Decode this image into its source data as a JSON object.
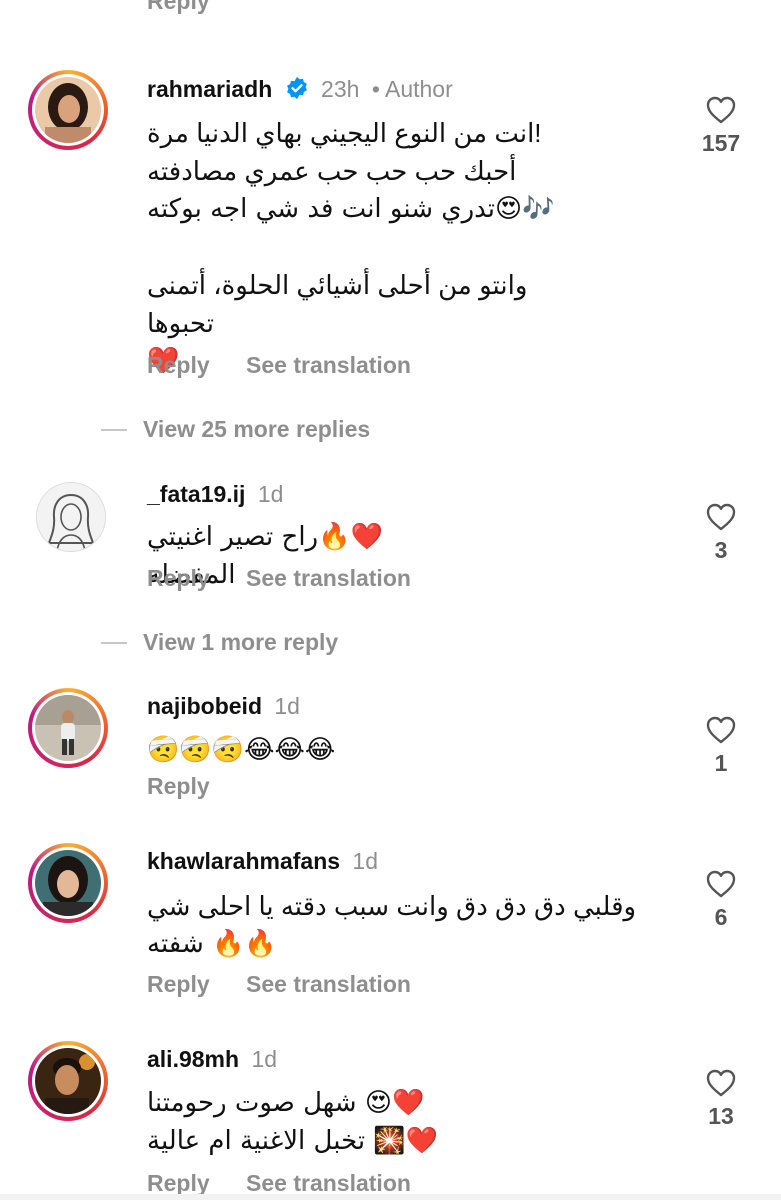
{
  "top_partial": {
    "label": "Reply"
  },
  "view_more": [
    "View 25 more replies",
    "View 1 more reply"
  ],
  "comments": [
    {
      "username": "rahmariadh",
      "time": "23h",
      "author_tag": "• Author",
      "lines": [
        "!انت من النوع اليجيني بهاي الدنيا مرة",
        "أحبك حب حب حب عمري مصادفته",
        "🎶😍تدري شنو انت فد شي اجه بوكته",
        "",
        "وانتو من أحلى أشيائي الحلوة، أتمنى تحبوها",
        "❤️"
      ],
      "reply": "Reply",
      "translate": "See translation",
      "likes": "157"
    },
    {
      "username": "_fata19.ij",
      "time": "1d",
      "lines": [
        "❤️🔥راح تصير اغنيتي المفضله"
      ],
      "reply": "Reply",
      "translate": "See translation",
      "likes": "3"
    },
    {
      "username": "najibobeid",
      "time": "1d",
      "lines": [
        "🤕🤕🤕😂😂😂"
      ],
      "reply": "Reply",
      "likes": "1"
    },
    {
      "username": "khawlarahmafans",
      "time": "1d",
      "lines": [
        "وقلبي دق دق دق وانت سبب دقته يا احلى شي",
        "🔥🔥 شفته"
      ],
      "reply": "Reply",
      "translate": "See translation",
      "likes": "6"
    },
    {
      "username": "ali.98mh",
      "time": "1d",
      "lines": [
        "❤️😍 شهل صوت رحومتنا",
        "❤️🎇 تخبل الاغنية ام عالية"
      ],
      "reply": "Reply",
      "translate": "See translation",
      "likes": "13"
    }
  ],
  "colors": {
    "muted": "#8e8e8e",
    "verified": "#0095f6",
    "text": "#111111"
  }
}
